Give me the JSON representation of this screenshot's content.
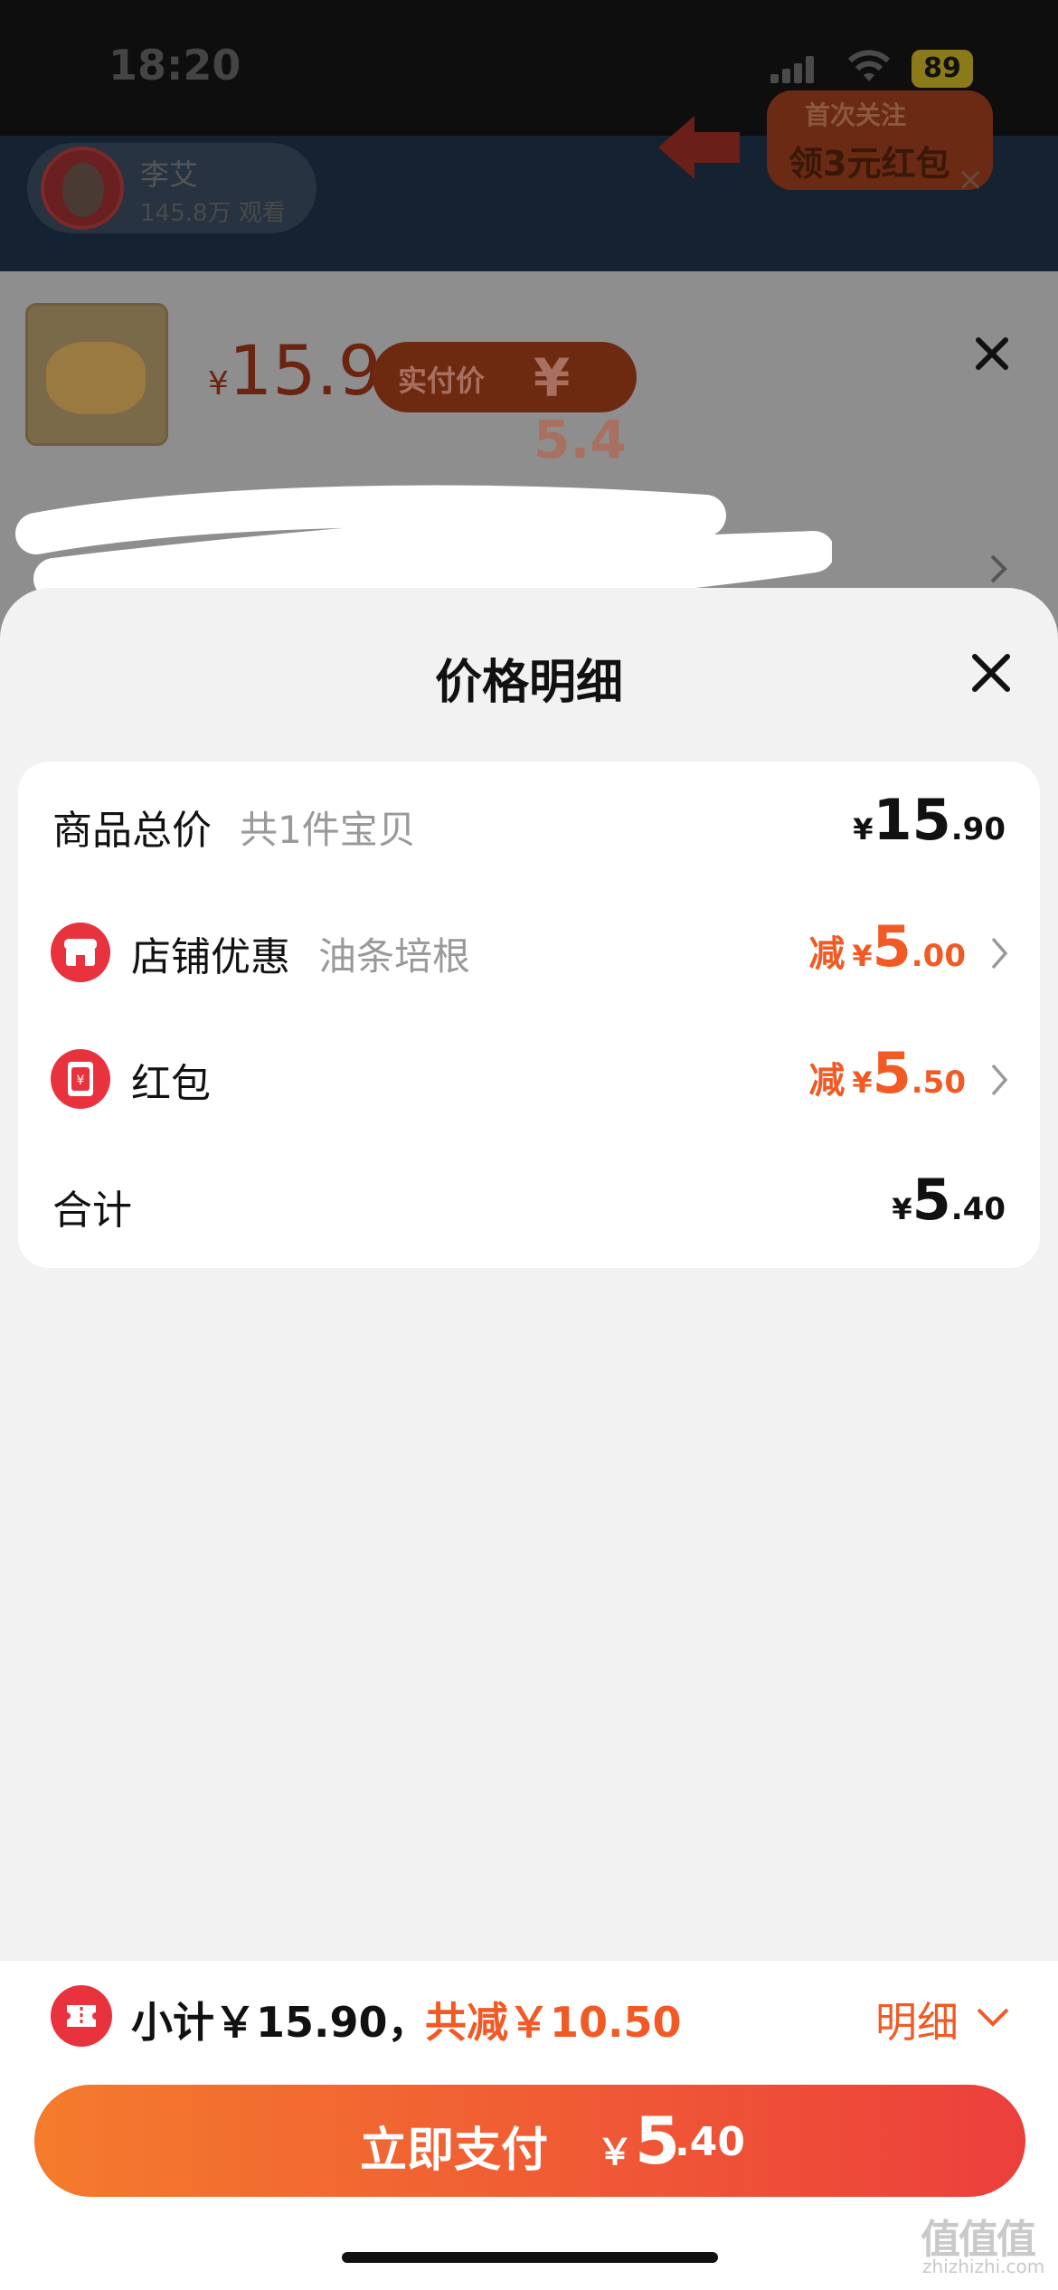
{
  "status_bar": {
    "time": "18:20",
    "battery": "89"
  },
  "live": {
    "anchor_name": "李艾",
    "anchor_viewers": "145.8万 观看",
    "promo_line1": "首次关注",
    "promo_line2": "领3元红包",
    "promo_close": "×"
  },
  "product": {
    "currency": "¥",
    "price": "15.9",
    "paid_label": "实付价",
    "paid_value": "¥ 5.4"
  },
  "modal": {
    "title": "价格明细",
    "rows": [
      {
        "label": "商品总价",
        "sub": "共1件宝贝",
        "prefix": "",
        "currency": "¥",
        "int": "15",
        "dec": ".90"
      },
      {
        "label": "店铺优惠",
        "sub": "油条培根",
        "prefix": "减",
        "currency": "¥",
        "int": "5",
        "dec": ".00"
      },
      {
        "label": "红包",
        "sub": "",
        "prefix": "减",
        "currency": "¥",
        "int": "5",
        "dec": ".50"
      },
      {
        "label": "合计",
        "sub": "",
        "prefix": "",
        "currency": "¥",
        "int": "5",
        "dec": ".40"
      }
    ]
  },
  "bottom": {
    "subtotal": "小计￥15.90，",
    "total_saved": "共减￥10.50",
    "detail": "明细",
    "pay_label": "立即支付",
    "pay_currency": "￥",
    "pay_int": "5",
    "pay_dec": ".40"
  },
  "watermark": {
    "main": "值值值",
    "sub": "zhizhizhi.com"
  },
  "colors": {
    "accent": "#f15a24",
    "red": "#e8333f",
    "gradient_start": "#f47b2c",
    "gradient_end": "#ec3f3c"
  }
}
